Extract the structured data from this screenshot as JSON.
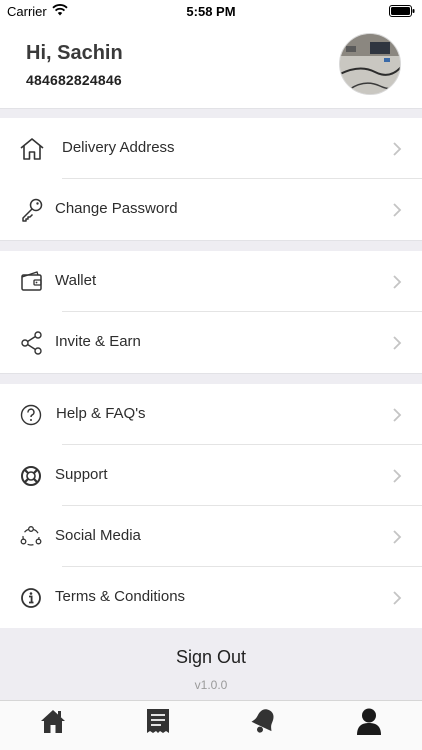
{
  "status_bar": {
    "carrier": "Carrier",
    "time": "5:58 PM"
  },
  "profile": {
    "greeting": "Hi, Sachin",
    "phone": "484682824846"
  },
  "menu": [
    {
      "label": "Delivery Address",
      "icon": "home-icon"
    },
    {
      "label": "Change Password",
      "icon": "key-icon"
    },
    {
      "label": "Wallet",
      "icon": "wallet-icon"
    },
    {
      "label": "Invite & Earn",
      "icon": "share-icon"
    },
    {
      "label": "Help & FAQ's",
      "icon": "question-icon"
    },
    {
      "label": "Support",
      "icon": "lifebuoy-icon"
    },
    {
      "label": "Social Media",
      "icon": "social-icon"
    },
    {
      "label": "Terms & Conditions",
      "icon": "info-icon"
    }
  ],
  "footer": {
    "signout": "Sign Out",
    "version": "v1.0.0"
  },
  "tabs": [
    {
      "name": "home-icon"
    },
    {
      "name": "orders-icon"
    },
    {
      "name": "notifications-icon"
    },
    {
      "name": "profile-icon",
      "active": true
    }
  ]
}
